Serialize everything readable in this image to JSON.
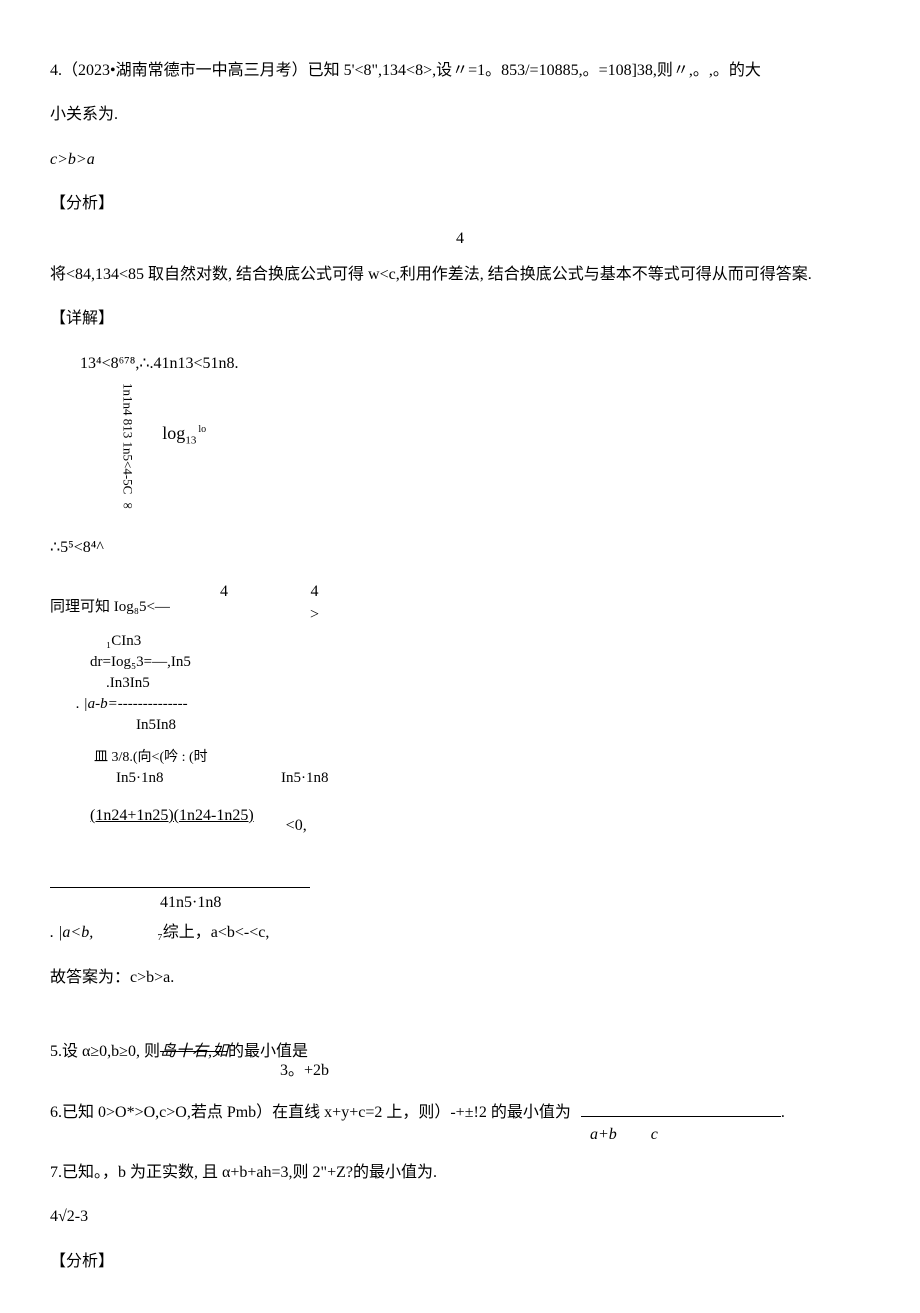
{
  "q4": {
    "stem": "4.（2023•湖南常德市一中高三月考）已知 5'<8\",134<8>,设〃=1。853/=10885,。=108]38,则〃,。,。的大",
    "stem2": "小关系为.",
    "answer_line": "c>b>a",
    "analysis_label": "【分析】",
    "center_four": "4",
    "analysis_text": "将<84,134<85 取自然对数, 结合换底公式可得 w<c,利用作差法, 结合换底公式与基本不等式可得从而可得答案.",
    "detail_label": "【详解】",
    "step1": "13⁴<8⁶⁷⁸,∴.41n13<51n8.",
    "vert_block": "1n1n4 813 1n5<4-5C ∞",
    "log13": "log",
    "log13_sub": "13",
    "log13_sup": "lo",
    "step2": "∴5⁵<8⁴^",
    "row44_label": "同理可知 Iog₈5<—",
    "row44_n1": "4",
    "row44_n2": "4",
    "row44_gt": ">",
    "dr_r1": "₁CIn3",
    "dr_r2": "dr=Iog₅3=—,In5",
    "dr_r3": ". |a-b=--------------",
    "dr_r3_pre": ".In3In5",
    "dr_r4": "In5In8",
    "m38_a": "皿 3/8.(向<(吟 : (时",
    "m38_b_left": "In5·1n8",
    "m38_b_right": "In5·1n8",
    "ln_underline": "(1n24+1n25)(1n24-1n25)",
    "ln_lt0": "<0,",
    "after_hr": "41n5·1n8",
    "row_alt_a": ". |a<b,",
    "row_alt_b": "₇综上，a<b<-<c,",
    "final": "故答案为：c>b>a."
  },
  "q5": {
    "stem_a": "5.设 α≥0,b≥0, 则",
    "stem_strike": "岛十右,如",
    "stem_b": "的最小值是",
    "sub": "3。+2b"
  },
  "q6": {
    "stem": "6.已知 0>O*>O,c>O,若点 Pmb）在直线 x+y+c=2 上，则）-+±!2 的最小值为",
    "dot": ".",
    "ab": "a+b",
    "c": "c"
  },
  "q7": {
    "stem": "7.已知。，b 为正实数, 且 α+b+ah=3,则 2\"+Z?的最小值为.",
    "answer": "4√2-3",
    "analysis_label": "【分析】"
  }
}
